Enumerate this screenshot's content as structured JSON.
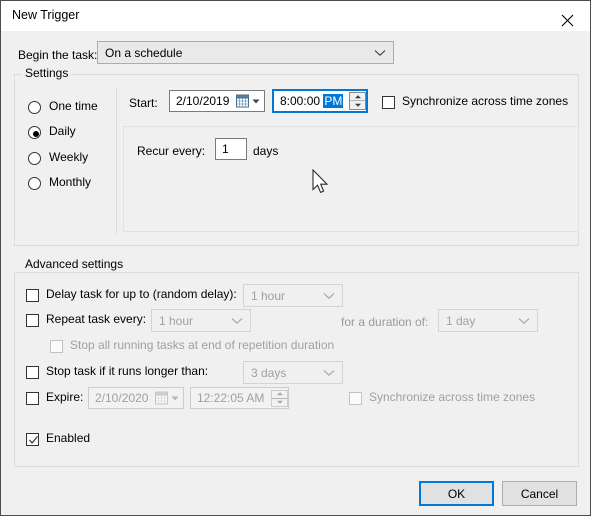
{
  "window": {
    "title": "New Trigger",
    "close_icon": "close-icon"
  },
  "begin": {
    "label": "Begin the task:",
    "value": "On a schedule"
  },
  "settings": {
    "caption": "Settings",
    "schedule_options": [
      {
        "label": "One time",
        "selected": false
      },
      {
        "label": "Daily",
        "selected": true
      },
      {
        "label": "Weekly",
        "selected": false
      },
      {
        "label": "Monthly",
        "selected": false
      }
    ],
    "start_label": "Start:",
    "start_date": "2/10/2019",
    "start_time_prefix": "8:00:00 ",
    "start_time_meridiem": "PM",
    "sync_timezones_label": "Synchronize across time zones",
    "recur_label": "Recur every:",
    "recur_value": "1",
    "recur_unit": "days"
  },
  "advanced": {
    "caption": "Advanced settings",
    "delay_label": "Delay task for up to (random delay):",
    "delay_value": "1 hour",
    "repeat_label": "Repeat task every:",
    "repeat_value": "1 hour",
    "duration_label": "for a duration of:",
    "duration_value": "1 day",
    "stop_repetition_label": "Stop all running tasks at end of repetition duration",
    "stop_task_label": "Stop task if it runs longer than:",
    "stop_task_value": "3 days",
    "expire_label": "Expire:",
    "expire_date": "2/10/2020",
    "expire_time": "12:22:05 AM",
    "expire_sync_label": "Synchronize across time zones",
    "enabled_label": "Enabled"
  },
  "footer": {
    "ok_label": "OK",
    "cancel_label": "Cancel"
  },
  "colors": {
    "accent": "#0078d7",
    "dialog_bg": "#f0f0f0",
    "titlebar_bg": "#ffffff",
    "disabled_text": "#a0a0a0"
  }
}
